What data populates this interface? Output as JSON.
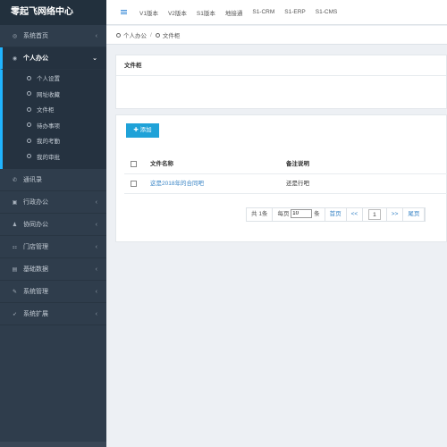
{
  "brand": "零起飞网络中心",
  "topnav": [
    "V1版本",
    "V2版本",
    "S1版本",
    "地接通",
    "S1-CRM",
    "S1-ERP",
    "S1-CMS"
  ],
  "breadcrumb": [
    "个人办公",
    "文件柜"
  ],
  "sidebar": {
    "items": [
      {
        "label": "系统首页",
        "icon": "gauge-icon",
        "chevron": "‹"
      },
      {
        "label": "个人办公",
        "icon": "circle-icon",
        "chevron": "⌄",
        "active": true
      },
      {
        "label": "通讯录",
        "icon": "phone-icon"
      },
      {
        "label": "行政办公",
        "icon": "briefcase-icon",
        "chevron": "‹"
      },
      {
        "label": "协同办公",
        "icon": "users-icon",
        "chevron": "‹"
      },
      {
        "label": "门店管理",
        "icon": "sitemap-icon",
        "chevron": "‹"
      },
      {
        "label": "基础数据",
        "icon": "database-icon",
        "chevron": "‹"
      },
      {
        "label": "系统管理",
        "icon": "wrench-icon",
        "chevron": "‹"
      },
      {
        "label": "系统扩展",
        "icon": "rocket-icon",
        "chevron": "‹"
      }
    ],
    "submenu": [
      "个人设置",
      "网址收藏",
      "文件柜",
      "待办事项",
      "我的考勤",
      "我的审批"
    ]
  },
  "panel_title": "文件柜",
  "add_button": "添加",
  "table": {
    "headers": [
      "文件名称",
      "备注说明"
    ],
    "rows": [
      {
        "name": "这是2018年的合同吧",
        "note": "还是行吧"
      }
    ]
  },
  "pager": {
    "total_prefix": "共",
    "total": "1条",
    "per_page_label": "每页",
    "per_page_value": "10",
    "per_page_unit": "条",
    "first": "首页",
    "prev": "<<",
    "current": "1",
    "next": ">>",
    "last": "尾页"
  },
  "colors": {
    "sidebar_bg": "#2f3d4c",
    "accent": "#20b4ff",
    "button": "#1fa2d8",
    "link": "#3a85c6"
  }
}
